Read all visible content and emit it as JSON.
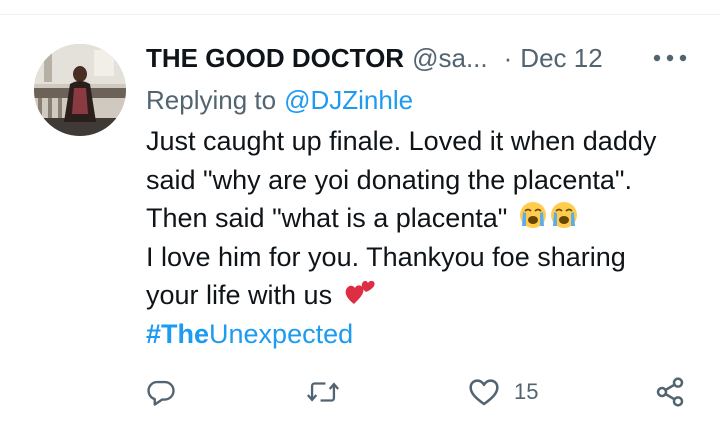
{
  "tweet": {
    "author_name": "THE GOOD DOCTOR",
    "handle": "@sa...",
    "separator": "·",
    "date": "Dec 12",
    "replying_prefix": "Replying to",
    "replying_to": "@DJZinhle",
    "lines": [
      "Just caught up finale. Loved it when daddy",
      "said \"why are yoi donating the placenta\".",
      "Then said \"what is a placenta\"",
      "I love him for you. Thankyou foe sharing",
      "your life with us"
    ],
    "hashtag_prefix": "#The",
    "hashtag_rest": "Unexpected",
    "like_count": "15"
  },
  "icons": {
    "more": "more-horizontal-icon",
    "reply": "reply-icon",
    "retweet": "retweet-icon",
    "like": "heart-icon",
    "share": "share-icon",
    "emoji_cry": "loudly-crying-face-emoji",
    "emoji_hearts": "two-hearts-emoji"
  },
  "colors": {
    "text": "#0f1419",
    "secondary": "#536471",
    "link": "#1d9bf0"
  }
}
